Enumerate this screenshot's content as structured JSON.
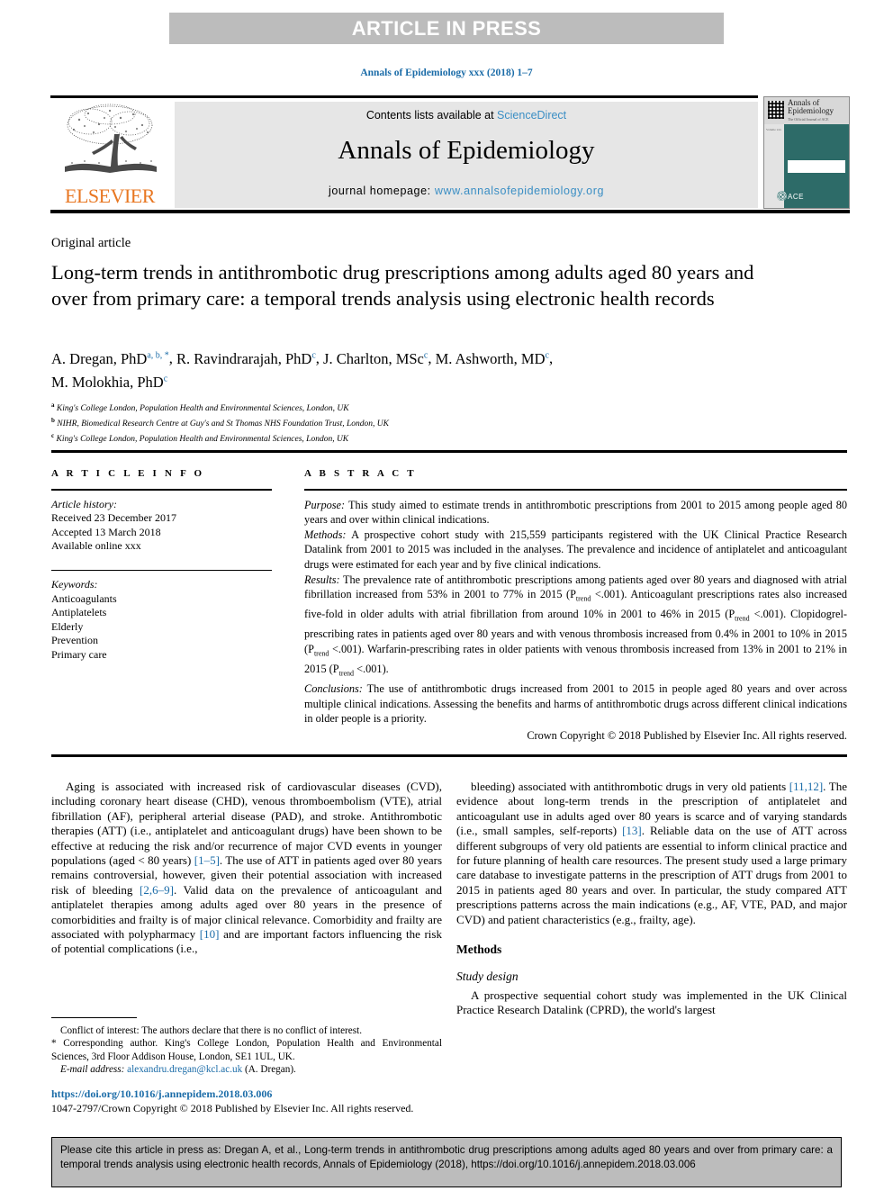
{
  "banner": {
    "text": "ARTICLE IN PRESS"
  },
  "running_head": "Annals of Epidemiology xxx (2018) 1–7",
  "masthead": {
    "contents_prefix": "Contents lists available at ",
    "contents_link": "ScienceDirect",
    "journal_name": "Annals of Epidemiology",
    "homepage_prefix": "journal homepage: ",
    "homepage_link": "www.annalsofepidemiology.org",
    "publisher_wordmark": "ELSEVIER",
    "cover": {
      "title": "Annals of Epidemiology",
      "subtitle": "The Official Journal of ACE",
      "society": "ACE",
      "spine_text": "Volume xxx"
    }
  },
  "article": {
    "kind": "Original article",
    "title": "Long-term trends in antithrombotic drug prescriptions among adults aged 80 years and over from primary care: a temporal trends analysis using electronic health records",
    "authors": [
      {
        "name": "A. Dregan, PhD",
        "marks": "a, b, *"
      },
      {
        "name": "R. Ravindrarajah, PhD",
        "marks": "c"
      },
      {
        "name": "J. Charlton, MSc",
        "marks": "c"
      },
      {
        "name": "M. Ashworth, MD",
        "marks": "c"
      },
      {
        "name": "M. Molokhia, PhD",
        "marks": "c"
      }
    ],
    "affiliations": [
      {
        "mark": "a",
        "text": "King's College London, Population Health and Environmental Sciences, London, UK"
      },
      {
        "mark": "b",
        "text": "NIHR, Biomedical Research Centre at Guy's and St Thomas NHS Foundation Trust, London, UK"
      },
      {
        "mark": "c",
        "text": "King's College London, Population Health and Environmental Sciences, London, UK"
      }
    ]
  },
  "article_info": {
    "heading": "A R T I C L E  I N F O",
    "history_label": "Article history:",
    "history": [
      "Received 23 December 2017",
      "Accepted 13 March 2018",
      "Available online xxx"
    ],
    "keywords_label": "Keywords:",
    "keywords": [
      "Anticoagulants",
      "Antiplatelets",
      "Elderly",
      "Prevention",
      "Primary care"
    ]
  },
  "abstract": {
    "heading": "A B S T R A C T",
    "purpose_label": "Purpose:",
    "purpose": "This study aimed to estimate trends in antithrombotic prescriptions from 2001 to 2015 among people aged 80 years and over within clinical indications.",
    "methods_label": "Methods:",
    "methods": "A prospective cohort study with 215,559 participants registered with the UK Clinical Practice Research Datalink from 2001 to 2015 was included in the analyses. The prevalence and incidence of antiplatelet and anticoagulant drugs were estimated for each year and by five clinical indications.",
    "results_label": "Results:",
    "results_part1": "The prevalence rate of antithrombotic prescriptions among patients aged over 80 years and diagnosed with atrial fibrillation increased from 53% in 2001 to 77% in 2015 (P",
    "results_sub": "trend",
    "results_part2": " <.001). Anticoagulant prescriptions rates also increased five-fold in older adults with atrial fibrillation from around 10% in 2001 to 46% in 2015 (P",
    "results_part3": " <.001). Clopidogrel-prescribing rates in patients aged over 80 years and with venous thrombosis increased from 0.4% in 2001 to 10% in 2015 (P",
    "results_part4": " <.001). Warfarin-prescribing rates in older patients with venous thrombosis increased from 13% in 2001 to 21% in 2015 (P",
    "results_part5": " <.001).",
    "conclusions_label": "Conclusions:",
    "conclusions": "The use of antithrombotic drugs increased from 2001 to 2015 in people aged 80 years and over across multiple clinical indications. Assessing the benefits and harms of antithrombotic drugs across different clinical indications in older people is a priority.",
    "copyright": "Crown Copyright © 2018 Published by Elsevier Inc. All rights reserved."
  },
  "body": {
    "left_p1_a": "Aging is associated with increased risk of cardiovascular diseases (CVD), including coronary heart disease (CHD), venous thromboembolism (VTE), atrial fibrillation (AF), peripheral arterial disease (PAD), and stroke. Antithrombotic therapies (ATT) (i.e., antiplatelet and anticoagulant drugs) have been shown to be effective at reducing the risk and/or recurrence of major CVD events in younger populations (aged < 80 years) ",
    "left_ref1": "[1–5]",
    "left_p1_b": ". The use of ATT in patients aged over 80 years remains controversial, however, given their potential association with increased risk of bleeding ",
    "left_ref2": "[2,6–9]",
    "left_p1_c": ". Valid data on the prevalence of anticoagulant and antiplatelet therapies among adults aged over 80 years in the presence of comorbidities and frailty is of major clinical relevance. Comorbidity and frailty are associated with polypharmacy ",
    "left_ref3": "[10]",
    "left_p1_d": " and are important factors influencing the risk of potential complications (i.e.,",
    "right_p1_a": "bleeding) associated with antithrombotic drugs in very old patients ",
    "right_ref1": "[11,12]",
    "right_p1_b": ". The evidence about long-term trends in the prescription of antiplatelet and anticoagulant use in adults aged over 80 years is scarce and of varying standards (i.e., small samples, self-reports) ",
    "right_ref2": "[13]",
    "right_p1_c": ". Reliable data on the use of ATT across different subgroups of very old patients are essential to inform clinical practice and for future planning of health care resources. The present study used a large primary care database to investigate patterns in the prescription of ATT drugs from 2001 to 2015 in patients aged 80 years and over. In particular, the study compared ATT prescriptions patterns across the main indications (e.g., AF, VTE, PAD, and major CVD) and patient characteristics (e.g., frailty, age).",
    "methods_heading": "Methods",
    "study_design_heading": "Study design",
    "study_design_p": "A prospective sequential cohort study was implemented in the UK Clinical Practice Research Datalink (CPRD), the world's largest"
  },
  "footnotes": {
    "conflict": "Conflict of interest: The authors declare that there is no conflict of interest.",
    "corresponding_mark": "*",
    "corresponding": " Corresponding author. King's College London, Population Health and Environmental Sciences, 3rd Floor Addison House, London, SE1 1UL, UK.",
    "email_label": "E-mail address:",
    "email": "alexandru.dregan@kcl.ac.uk",
    "email_suffix": " (A. Dregan).",
    "doi": "https://doi.org/10.1016/j.annepidem.2018.03.006",
    "imprint_line": "1047-2797/Crown Copyright © 2018 Published by Elsevier Inc. All rights reserved."
  },
  "citation_box": {
    "text": "Please cite this article in press as: Dregan A, et al., Long-term trends in antithrombotic drug prescriptions among adults aged 80 years and over from primary care: a temporal trends analysis using electronic health records, Annals of Epidemiology (2018), https://doi.org/10.1016/j.annepidem.2018.03.006"
  },
  "colors": {
    "banner_bg": "#bcbcbc",
    "link_blue": "#1b6ca8",
    "sciencedirect_blue": "#3a8ec4",
    "elsevier_orange": "#e87722",
    "masthead_gray": "#e6e6e6",
    "cover_teal": "#2d6b68"
  }
}
